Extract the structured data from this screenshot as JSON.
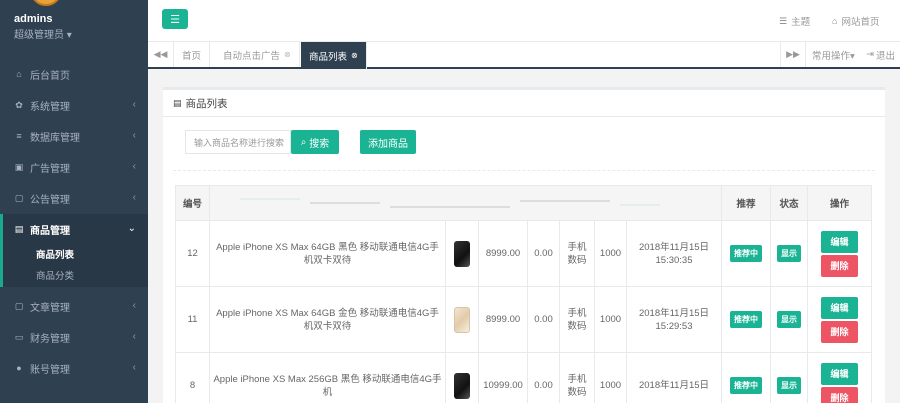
{
  "sidebar": {
    "user_name": "admins",
    "user_role": "超级管理员 ▾",
    "items": [
      {
        "label": "后台首页",
        "icon": "home-icon",
        "glyph": "⌂",
        "arrow": ""
      },
      {
        "label": "系统管理",
        "icon": "gear-icon",
        "glyph": "✿",
        "arrow": "‹"
      },
      {
        "label": "数据库管理",
        "icon": "database-icon",
        "glyph": "≡",
        "arrow": "‹"
      },
      {
        "label": "广告管理",
        "icon": "copy-icon",
        "glyph": "▣",
        "arrow": "‹"
      },
      {
        "label": "公告管理",
        "icon": "file-icon",
        "glyph": "▢",
        "arrow": "‹"
      },
      {
        "label": "商品管理",
        "icon": "file-icon",
        "glyph": "▤",
        "arrow": "⌄"
      },
      {
        "label": "文章管理",
        "icon": "file-icon",
        "glyph": "▢",
        "arrow": "‹"
      },
      {
        "label": "财务管理",
        "icon": "money-icon",
        "glyph": "▭",
        "arrow": "‹"
      },
      {
        "label": "账号管理",
        "icon": "user-icon",
        "glyph": "●",
        "arrow": "‹"
      }
    ],
    "sub_items": [
      "商品列表",
      "商品分类"
    ]
  },
  "topbar": {
    "theme": "主题",
    "home": "网站首页"
  },
  "tabs": {
    "home": "首页",
    "auto_ad": "自动点击广告",
    "product_list": "商品列表",
    "common_ops": "常用操作▾",
    "logout": "退出"
  },
  "panel": {
    "title": "商品列表",
    "search_placeholder": "输入商品名称进行搜索",
    "search_btn": "搜索",
    "add_btn": "添加商品"
  },
  "table": {
    "headers": {
      "id": "编号",
      "recommend": "推荐",
      "status": "状态",
      "ops": "操作"
    },
    "rows": [
      {
        "id": "12",
        "name": "Apple iPhone XS Max 64GB 黑色 移动联通电信4G手机双卡双待",
        "img": "black",
        "price": "8999.00",
        "cost": "0.00",
        "category": "手机数码",
        "stock": "1000",
        "time": "2018年11月15日 15:30:35",
        "recommend": "推荐中",
        "status": "显示",
        "edit": "编辑",
        "delete": "删除"
      },
      {
        "id": "11",
        "name": "Apple iPhone XS Max 64GB 金色 移动联通电信4G手机双卡双待",
        "img": "gold",
        "price": "8999.00",
        "cost": "0.00",
        "category": "手机数码",
        "stock": "1000",
        "time": "2018年11月15日 15:29:53",
        "recommend": "推荐中",
        "status": "显示",
        "edit": "编辑",
        "delete": "删除"
      },
      {
        "id": "8",
        "name": "Apple iPhone XS Max 256GB 黑色 移动联通电信4G手机",
        "img": "black",
        "price": "10999.00",
        "cost": "0.00",
        "category": "手机数码",
        "stock": "1000",
        "time": "2018年11月15日",
        "recommend": "推荐中",
        "status": "显示",
        "edit": "编辑",
        "delete": "删除"
      }
    ]
  },
  "colors": {
    "sidebar_bg": "#2f4050",
    "accent": "#1ab394",
    "danger": "#ed5565"
  }
}
